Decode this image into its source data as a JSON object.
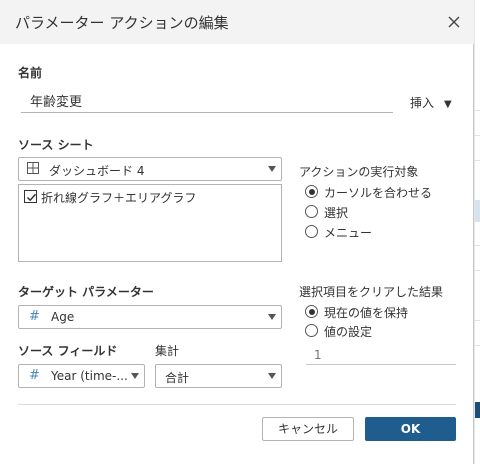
{
  "dialog": {
    "title": "パラメーター アクションの編集",
    "close_icon": "close-icon"
  },
  "name_section": {
    "label": "名前",
    "value": "年齢変更",
    "insert_label": "挿入",
    "insert_caret": "▼"
  },
  "source_sheet": {
    "label": "ソース シート",
    "dashboard_icon": "dashboard-icon",
    "selected": "ダッシュボード 4",
    "items": [
      {
        "checked": true,
        "label": "折れ線グラフ＋エリアグラフ"
      }
    ]
  },
  "run_action_on": {
    "label": "アクションの実行対象",
    "options": [
      {
        "label": "カーソルを合わせる",
        "checked": true
      },
      {
        "label": "選択",
        "checked": false
      },
      {
        "label": "メニュー",
        "checked": false
      }
    ]
  },
  "target_parameter": {
    "label": "ターゲット パラメーター",
    "icon": "hash-icon",
    "icon_glyph": "#",
    "selected": "Age"
  },
  "source_field": {
    "label": "ソース フィールド",
    "icon": "hash-icon",
    "icon_glyph": "#",
    "selected": "Year (time-..."
  },
  "aggregation": {
    "label": "集計",
    "selected": "合計"
  },
  "clearing_selection": {
    "label": "選択項目をクリアした結果",
    "options": [
      {
        "label": "現在の値を保持",
        "checked": true
      },
      {
        "label": "値の設定",
        "checked": false
      }
    ],
    "value_placeholder": "1"
  },
  "buttons": {
    "cancel": "キャンセル",
    "ok": "OK"
  },
  "colors": {
    "ok_button": "#1f5d8e",
    "titlebar": "#f3f3f3",
    "background_app_accent": "#1a4f7a"
  }
}
